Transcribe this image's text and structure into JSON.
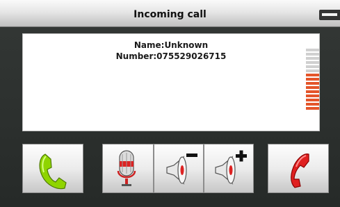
{
  "window": {
    "title": "Incoming call"
  },
  "caller": {
    "name_line": "Name:Unknown",
    "number_line": "Number:075529026715"
  },
  "volume": {
    "level": 0.6,
    "segments_total": 15,
    "segments_active": 9,
    "inactive_color": "#d0d0d0",
    "active_color": "#e4552a"
  },
  "controls": {
    "answer_icon": "phone-green-icon",
    "mic_icon": "microphone-icon",
    "volume_down_icon": "speaker-minus-icon",
    "volume_up_icon": "speaker-plus-icon",
    "hangup_icon": "phone-red-icon",
    "answer_color": "#8fd400",
    "hangup_color": "#e02020"
  }
}
